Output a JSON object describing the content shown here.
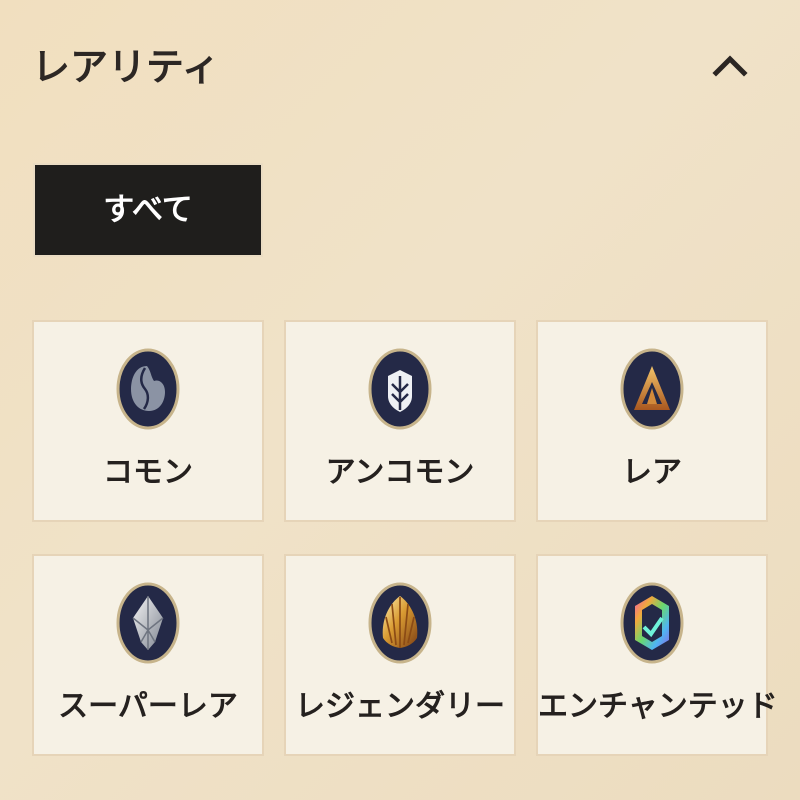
{
  "filter_panel": {
    "title": "レアリティ",
    "collapse_icon": "chevron-up-icon",
    "all_label": "すべて",
    "colors": {
      "background": "#f0e2c8",
      "button_dark": "#1f1e1c",
      "card_background": "#f6f1e5",
      "emblem_navy": "#242947",
      "emblem_rim": "#c7b48b"
    },
    "rarities": [
      {
        "label": "コモン",
        "icon": "common-rarity-icon"
      },
      {
        "label": "アンコモン",
        "icon": "uncommon-rarity-icon"
      },
      {
        "label": "レア",
        "icon": "rare-rarity-icon"
      },
      {
        "label": "スーパーレア",
        "icon": "super-rare-rarity-icon"
      },
      {
        "label": "レジェンダリー",
        "icon": "legendary-rarity-icon"
      },
      {
        "label": "エンチャンテッド",
        "icon": "enchanted-rarity-icon"
      }
    ]
  }
}
